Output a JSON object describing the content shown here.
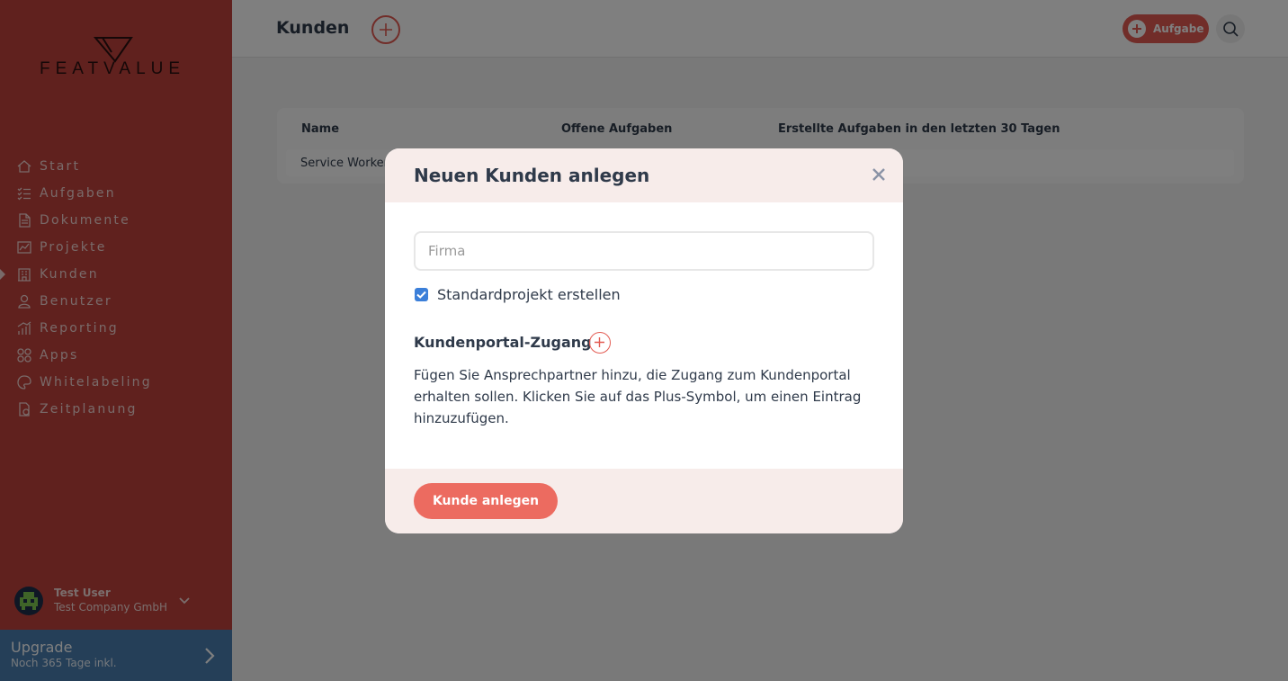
{
  "brand": {
    "logo_text": "FEATVALUE",
    "accent": "#e35b52",
    "sidebar_bg": "#c0423c"
  },
  "sidebar": {
    "items": [
      {
        "label": "Start",
        "icon": "home-icon"
      },
      {
        "label": "Aufgaben",
        "icon": "tasks-icon"
      },
      {
        "label": "Dokumente",
        "icon": "documents-icon"
      },
      {
        "label": "Projekte",
        "icon": "projects-icon"
      },
      {
        "label": "Kunden",
        "icon": "customers-icon",
        "active": true
      },
      {
        "label": "Benutzer",
        "icon": "user-icon"
      },
      {
        "label": "Reporting",
        "icon": "reporting-icon"
      },
      {
        "label": "Apps",
        "icon": "apps-icon"
      },
      {
        "label": "Whitelabeling",
        "icon": "whitelabel-icon"
      },
      {
        "label": "Zeitplanung",
        "icon": "calendar-icon"
      }
    ],
    "user": {
      "name": "Test User",
      "company": "Test Company GmbH"
    },
    "upgrade": {
      "title": "Upgrade",
      "subtitle": "Noch 365 Tage inkl."
    }
  },
  "header": {
    "title": "Kunden",
    "task_button": "Aufgabe"
  },
  "table": {
    "columns": [
      "Name",
      "Offene Aufgaben",
      "Erstellte Aufgaben in den letzten 30 Tagen"
    ],
    "rows": [
      {
        "name": "Service Worker"
      }
    ]
  },
  "modal": {
    "title": "Neuen Kunden anlegen",
    "firma_placeholder": "Firma",
    "firma_value": "",
    "checkbox_label": "Standardprojekt erstellen",
    "checkbox_checked": true,
    "section_title": "Kundenportal-Zugang",
    "section_description": "Fügen Sie Ansprechpartner hinzu, die Zugang zum Kundenportal erhalten sollen. Klicken Sie auf das Plus-Symbol, um einen Eintrag hinzuzufügen.",
    "submit_label": "Kunde anlegen"
  }
}
